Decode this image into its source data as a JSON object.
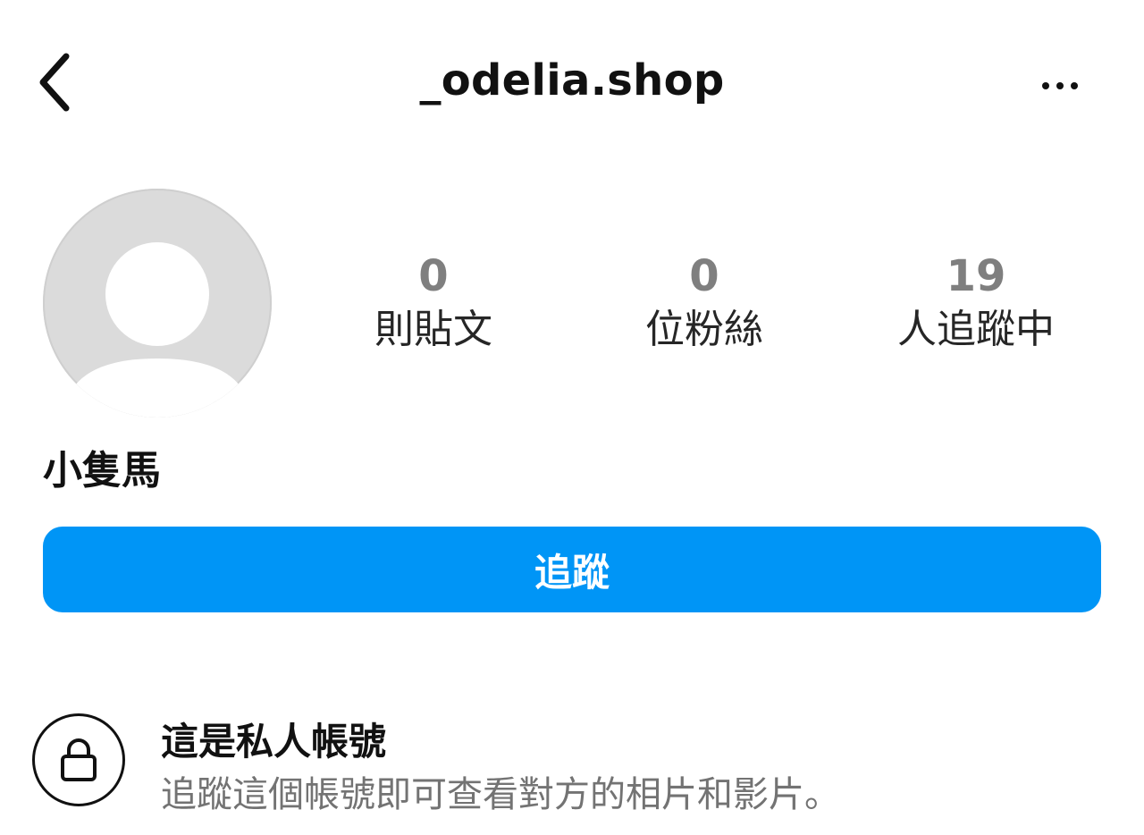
{
  "header": {
    "username": "_odelia.shop",
    "back_icon": "chevron-left-icon",
    "more_icon": "more-horizontal-icon"
  },
  "profile": {
    "avatar_icon": "default-avatar-icon",
    "display_name": "小隻馬"
  },
  "stats": [
    {
      "value": "0",
      "label": "則貼文"
    },
    {
      "value": "0",
      "label": "位粉絲"
    },
    {
      "value": "19",
      "label": "人追蹤中"
    }
  ],
  "follow_button": {
    "label": "追蹤",
    "color": "#0095f6"
  },
  "private_notice": {
    "icon": "lock-icon",
    "title": "這是私人帳號",
    "description": "追蹤這個帳號即可查看對方的相片和影片。"
  }
}
